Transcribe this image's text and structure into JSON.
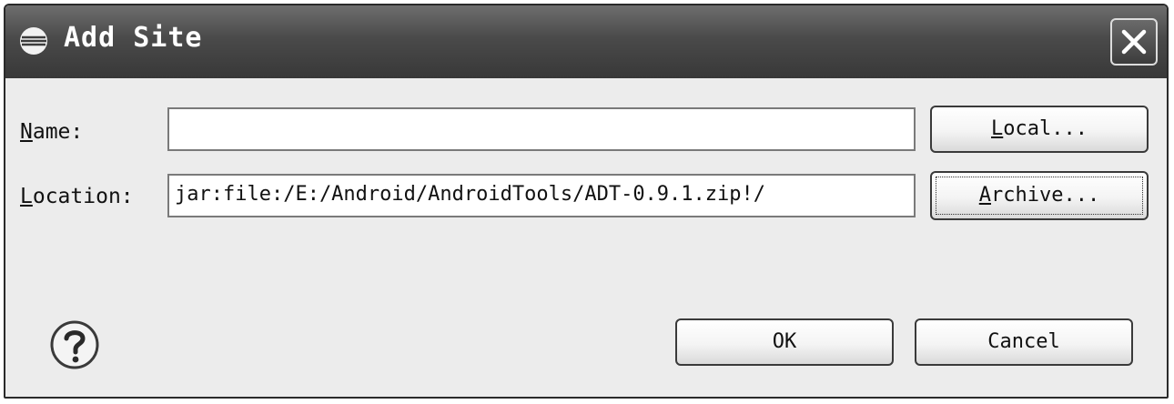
{
  "window": {
    "title": "Add Site",
    "close_symbol": "×"
  },
  "form": {
    "name_label_mnemonic": "N",
    "name_label_rest": "ame:",
    "name_value": "",
    "location_label_mnemonic": "L",
    "location_label_rest": "ocation:",
    "location_value": "jar:file:/E:/Android/AndroidTools/ADT-0.9.1.zip!/"
  },
  "buttons": {
    "local_mnemonic": "L",
    "local_rest": "ocal...",
    "archive_mnemonic": "A",
    "archive_rest": "rchive...",
    "ok": "OK",
    "cancel": "Cancel"
  },
  "icons": {
    "window_icon": "eclipse-icon",
    "close_icon": "close-icon",
    "help_icon": "help-icon"
  }
}
